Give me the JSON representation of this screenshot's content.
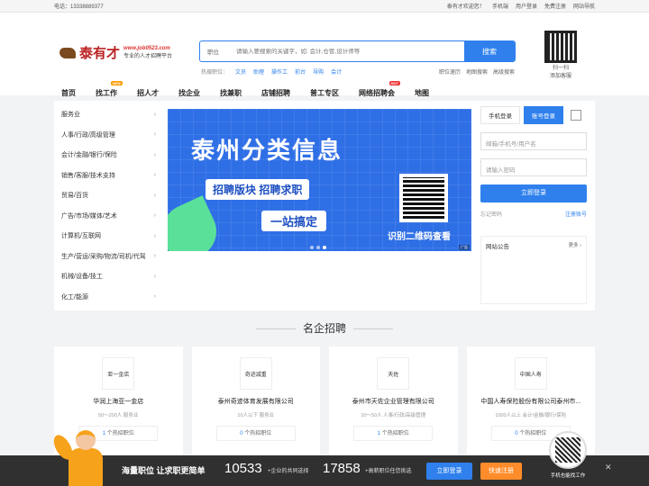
{
  "topbar": {
    "phone": "电话：13338889377",
    "welcome": "泰有才欢迎您！",
    "links": [
      "手机端",
      "用户登录",
      "免费注册",
      "网站导航"
    ]
  },
  "logo": {
    "brand": "泰有才",
    "url": "www.job0523.com",
    "slogan": "专业的人才招聘平台"
  },
  "search": {
    "select": "职位",
    "placeholder": "请输入要搜索的关键字，如: 会计,仓管,设计师等",
    "button": "搜索",
    "hot_label": "热搜职位：",
    "hot": [
      "文员",
      "助理",
      "操作工",
      "前台",
      "导购",
      "会计"
    ],
    "quick": [
      "职位速历",
      "地图搜索",
      "高级搜索"
    ]
  },
  "qr_top": {
    "line1": "扫一扫",
    "line2": "添加客服"
  },
  "nav": {
    "items": [
      "首页",
      "找工作",
      "招人才",
      "找企业",
      "找兼职",
      "店铺招聘",
      "普工专区",
      "网络招聘会",
      "地图"
    ],
    "badge_new": "NEW",
    "badge_hot": "HOT"
  },
  "categories": [
    "服务业",
    "人事/行政/高级管理",
    "会计/金融/银行/保险",
    "销售/客服/技术支持",
    "贸易/百货",
    "广告/市场/媒体/艺术",
    "计算机/互联网",
    "生产/营运/采购/物流/司机/代驾",
    "机械/设备/技工",
    "化工/能源"
  ],
  "banner": {
    "title": "泰州分类信息",
    "tag1": "招聘版块  招聘求职",
    "tag2": "一站搞定",
    "scan": "识别二维码查看",
    "ad": "广告"
  },
  "login": {
    "tab_phone": "手机登录",
    "tab_account": "账号登录",
    "field_user": "邮箱/手机号/用户名",
    "field_pwd": "请输入密码",
    "button": "立即登录",
    "forgot": "忘记密码",
    "register": "注册账号"
  },
  "notice": {
    "title": "网站公告",
    "more": "更多"
  },
  "section": {
    "title": "名企招聘"
  },
  "companies": [
    {
      "name": "华润上海亚一金店",
      "info": "50～200人   服务业",
      "count": "1",
      "suffix": " 个热招职位",
      "logo": "亚一金店"
    },
    {
      "name": "泰州奇迹体育发展有限公司",
      "info": "10人以下   服务业",
      "count": "0",
      "suffix": " 个热招职位",
      "logo": "奇迹减重"
    },
    {
      "name": "泰州市天佐企业管理有限公司",
      "info": "10～50人   人事/行政/高级管理",
      "count": "1",
      "suffix": " 个热招职位",
      "logo": "天佐"
    },
    {
      "name": "中国人寿保险股份有限公司泰州市...",
      "info": "1000人以上   会计/金融/银行/保险",
      "count": "0",
      "suffix": " 个热招职位",
      "logo": "中国人寿"
    }
  ],
  "footer": {
    "slogan": "海量职位 让求职更简单",
    "num1": "10533",
    "label1": "+企业的共同选择",
    "num2": "17858",
    "label2": "+高薪职位任您挑选",
    "btn_login": "立即登录",
    "btn_register": "快速注册",
    "close": "✕"
  },
  "float_qr": {
    "caption": "手机也能找工作"
  },
  "colors": {
    "accent": "#2f80ed",
    "orange": "#ff8c2a"
  }
}
